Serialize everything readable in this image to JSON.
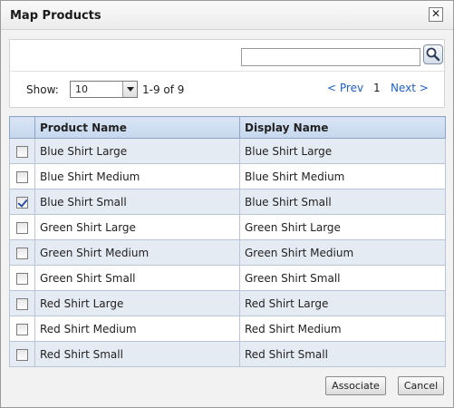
{
  "dialog": {
    "title": "Map Products",
    "close_label": "✕"
  },
  "toolbar": {
    "search_value": "",
    "show_label": "Show:",
    "page_size": "10",
    "range_text": "1-9 of 9",
    "prev_label": "< Prev",
    "current_page": "1",
    "next_label": "Next >"
  },
  "table": {
    "columns": [
      "Product Name",
      "Display Name"
    ],
    "rows": [
      {
        "product": "Blue Shirt Large",
        "display": "Blue Shirt Large",
        "checked": false
      },
      {
        "product": "Blue Shirt Medium",
        "display": "Blue Shirt Medium",
        "checked": false
      },
      {
        "product": "Blue Shirt Small",
        "display": "Blue Shirt Small",
        "checked": true
      },
      {
        "product": "Green Shirt Large",
        "display": "Green Shirt Large",
        "checked": false
      },
      {
        "product": "Green Shirt Medium",
        "display": "Green Shirt Medium",
        "checked": false
      },
      {
        "product": "Green Shirt Small",
        "display": "Green Shirt Small",
        "checked": false
      },
      {
        "product": "Red Shirt Large",
        "display": "Red Shirt Large",
        "checked": false
      },
      {
        "product": "Red Shirt Medium",
        "display": "Red Shirt Medium",
        "checked": false
      },
      {
        "product": "Red Shirt Small",
        "display": "Red Shirt Small",
        "checked": false
      }
    ]
  },
  "footer": {
    "associate_label": "Associate",
    "cancel_label": "Cancel"
  },
  "icons": {
    "search": "search-icon",
    "close": "close-icon",
    "dropdown": "chevron-down-icon"
  },
  "colors": {
    "link": "#1f5fc4",
    "header_bg": "#c6d7ee",
    "row_alt": "#e5ebf3",
    "check": "#2a4fa0"
  }
}
